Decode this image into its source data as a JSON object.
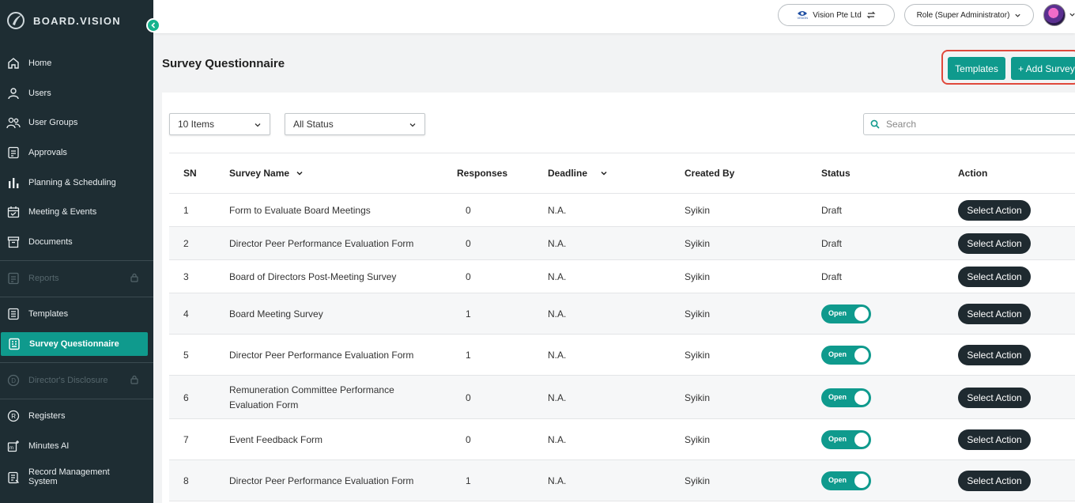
{
  "app": {
    "brand": "BOARD.VISION"
  },
  "sidebar": {
    "items": [
      {
        "label": "Home",
        "icon": "home-icon"
      },
      {
        "label": "Users",
        "icon": "user-icon"
      },
      {
        "label": "User Groups",
        "icon": "user-group-icon"
      },
      {
        "label": "Approvals",
        "icon": "approvals-icon"
      },
      {
        "label": "Planning & Scheduling",
        "icon": "bar-chart-icon"
      },
      {
        "label": "Meeting & Events",
        "icon": "calendar-check-icon"
      },
      {
        "label": "Documents",
        "icon": "archive-icon"
      },
      {
        "label": "Reports",
        "icon": "report-icon",
        "disabled": true
      },
      {
        "label": "Templates",
        "icon": "template-icon"
      },
      {
        "label": "Survey Questionnaire",
        "icon": "survey-icon",
        "active": true
      },
      {
        "label": "Director's Disclosure",
        "icon": "disclosure-icon",
        "disabled": true
      },
      {
        "label": "Registers",
        "icon": "registered-icon"
      },
      {
        "label": "Minutes AI",
        "icon": "minutes-ai-icon"
      },
      {
        "label": "Record Management System",
        "icon": "records-icon"
      }
    ]
  },
  "topbar": {
    "org": "Vision Pte Ltd",
    "org_logo_text": "VISION",
    "role": "Role (Super Administrator)"
  },
  "page": {
    "title": "Survey Questionnaire",
    "templates_button": "Templates",
    "add_button": "+ Add Survey"
  },
  "filters": {
    "items_per_page": "10 Items",
    "status": "All Status",
    "search_placeholder": "Search"
  },
  "table": {
    "columns": {
      "sn": "SN",
      "name": "Survey Name",
      "responses": "Responses",
      "deadline": "Deadline",
      "created_by": "Created By",
      "status": "Status",
      "action": "Action"
    },
    "open_label": "Open",
    "action_label": "Select Action",
    "rows": [
      {
        "sn": "1",
        "name": "Form to Evaluate Board Meetings",
        "responses": "0",
        "deadline": "N.A.",
        "created_by": "Syikin",
        "status": "Draft"
      },
      {
        "sn": "2",
        "name": "Director Peer Performance Evaluation Form",
        "responses": "0",
        "deadline": "N.A.",
        "created_by": "Syikin",
        "status": "Draft"
      },
      {
        "sn": "3",
        "name": "Board of Directors Post-Meeting Survey",
        "responses": "0",
        "deadline": "N.A.",
        "created_by": "Syikin",
        "status": "Draft"
      },
      {
        "sn": "4",
        "name": "Board Meeting Survey",
        "responses": "1",
        "deadline": "N.A.",
        "created_by": "Syikin",
        "status": "Open"
      },
      {
        "sn": "5",
        "name": "Director Peer Performance Evaluation Form",
        "responses": "1",
        "deadline": "N.A.",
        "created_by": "Syikin",
        "status": "Open"
      },
      {
        "sn": "6",
        "name": "Remuneration Committee Performance Evaluation Form",
        "responses": "0",
        "deadline": "N.A.",
        "created_by": "Syikin",
        "status": "Open"
      },
      {
        "sn": "7",
        "name": "Event Feedback Form",
        "responses": "0",
        "deadline": "N.A.",
        "created_by": "Syikin",
        "status": "Open"
      },
      {
        "sn": "8",
        "name": "Director Peer Performance Evaluation Form",
        "responses": "1",
        "deadline": "N.A.",
        "created_by": "Syikin",
        "status": "Open"
      }
    ]
  },
  "colors": {
    "teal": "#0f9a8d",
    "sidebar_bg": "#1e2d33",
    "highlight": "#e0483b",
    "action_btn": "#1f2a30"
  }
}
